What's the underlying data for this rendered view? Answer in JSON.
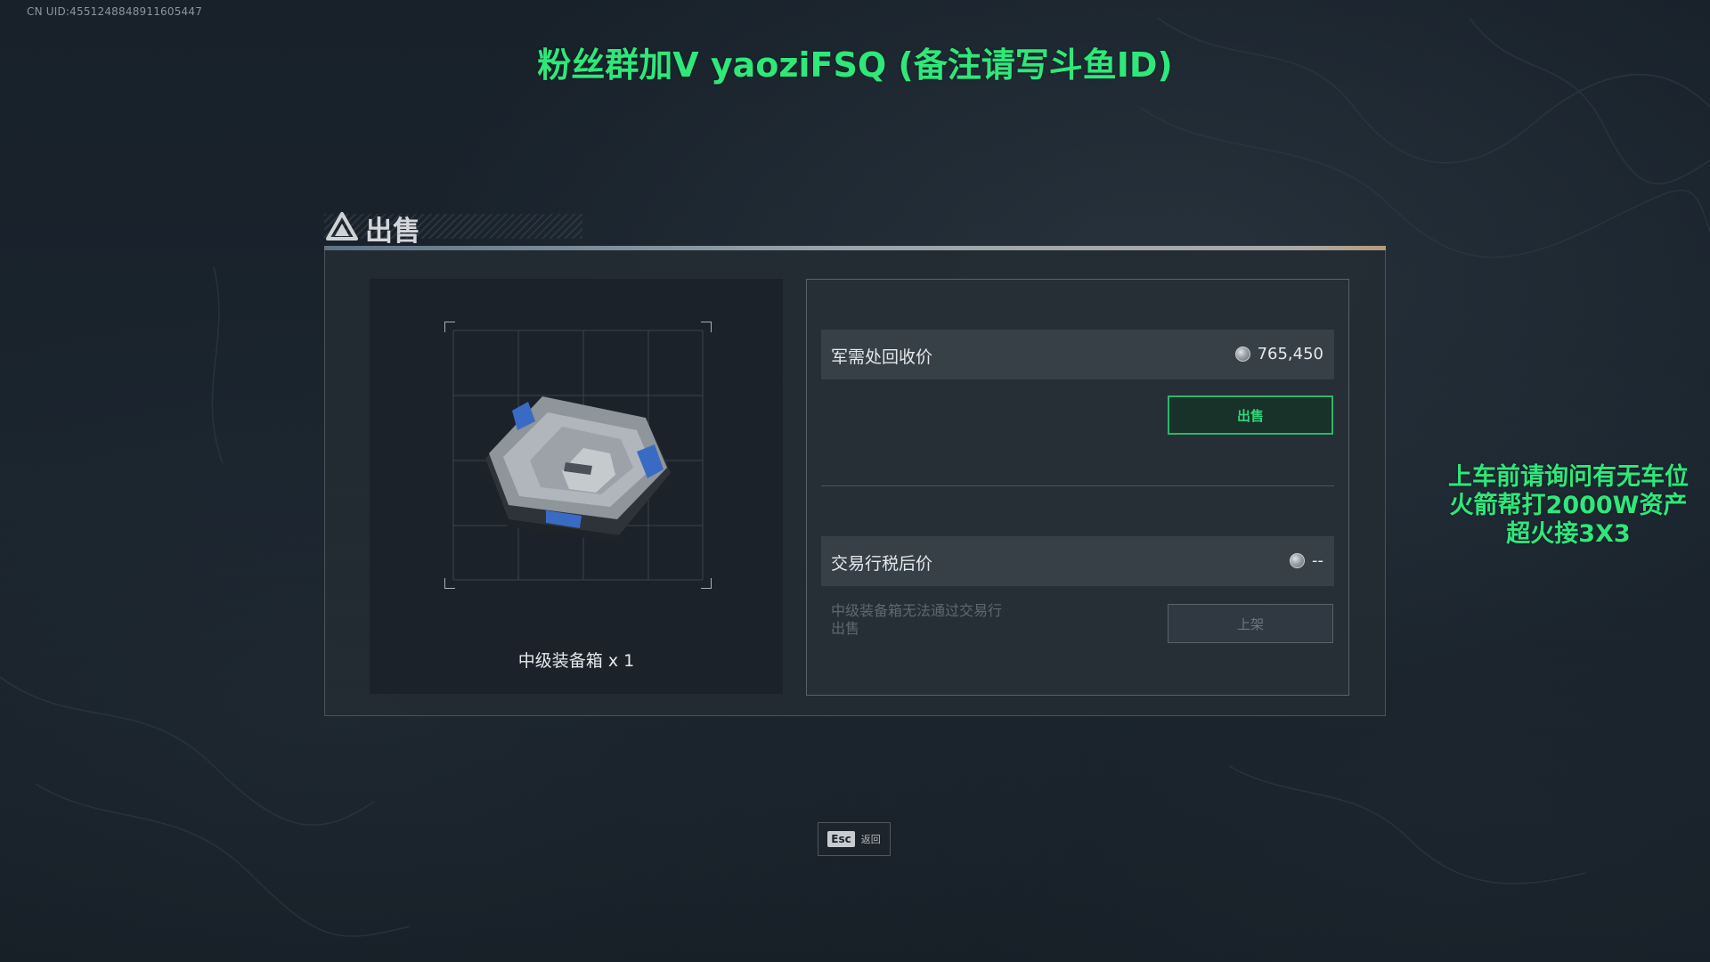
{
  "overlay": {
    "uid": "CN UID:4551248848911605447",
    "promo_top": "粉丝群加V yaoziFSQ (备注请写斗鱼ID)",
    "promo_right_lines": [
      "上车前请询问有无车位",
      "火箭帮打2000W资产",
      "超火接3X3"
    ]
  },
  "panel": {
    "title": "出售",
    "item": {
      "name": "中级装备箱 x 1",
      "icon": "equipment-case-icon"
    },
    "recycle": {
      "label": "军需处回收价",
      "value": "765,450",
      "currency_icon": "coin-icon",
      "sell_button": "出售"
    },
    "trade": {
      "label": "交易行税后价",
      "value": "--",
      "currency_icon": "coin-icon",
      "note": "中级装备箱无法通过交易行出售",
      "list_button": "上架"
    }
  },
  "footer": {
    "esc_key": "Esc",
    "esc_label": "返回"
  },
  "colors": {
    "accent_green": "#2ee87a",
    "button_border": "#2fb56a",
    "panel_bg": "#242c33"
  }
}
